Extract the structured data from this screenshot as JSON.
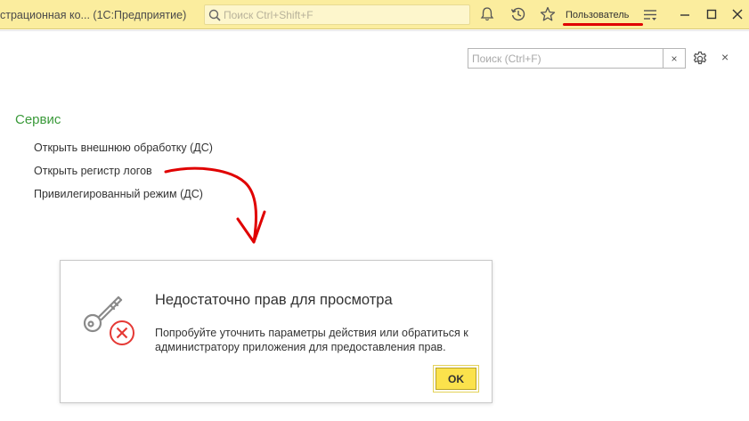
{
  "titlebar": {
    "title": "страционная ко...  (1С:Предприятие)",
    "search_placeholder": "Поиск Ctrl+Shift+F",
    "user": "Пользователь"
  },
  "toolbar": {
    "search_placeholder": "Поиск (Ctrl+F)",
    "clear_label": "×",
    "close_label": "×"
  },
  "section": {
    "title": "Сервис",
    "commands": [
      "Открыть внешнюю обработку (ДС)",
      "Открыть регистр логов",
      "Привилегированный режим (ДС)"
    ]
  },
  "dialog": {
    "title": "Недостаточно прав для просмотра",
    "message": "Попробуйте уточнить параметры действия или обратиться к администратору приложения для предоставления прав.",
    "ok_label": "OK"
  },
  "colors": {
    "titlebar_bg": "#fbed9e",
    "section_green": "#3a9a3a",
    "ok_yellow": "#fbe24c",
    "error_red": "#e53935",
    "annotation_red": "#e00000"
  },
  "icons": [
    "search-icon",
    "bell-icon",
    "history-icon",
    "star-icon",
    "menu-icon",
    "minimize-icon",
    "maximize-icon",
    "close-icon",
    "gear-icon",
    "key-icon",
    "error-icon"
  ]
}
